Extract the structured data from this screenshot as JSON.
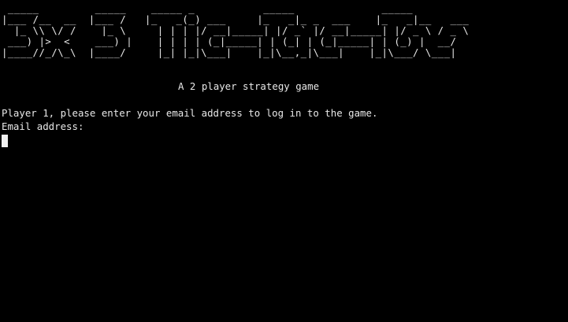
{
  "terminal": {
    "banner_lines": [
      " _____         _____    _____ _           _____              _____",
      "|___ /__  __  |___ /   |_   _(_) ___     |_   _|_ _  ___    |_   _|__   ___",
      "  |_ \\\\ \\/ /    |_ \\     | | | |/ __|_____| |/ _` |/ __|_____| |/ _ \\ / _ \\",
      " ___) |>  <    ___) |    | | | | (_|_____| | (_| | (_|_____| | (_) |  __/",
      "|____//_/\\_\\  |____/     |_| |_|\\___|    |_|\\__,_|\\___|    |_|\\___/ \\___|"
    ],
    "subtitle": "A 2 player strategy game",
    "prompt": "Player 1, please enter your email address to log in to the game.",
    "input_label": "Email address:",
    "colors": {
      "background": "#000000",
      "text": "#e8e8e8",
      "cursor": "#f0f0f0"
    }
  }
}
